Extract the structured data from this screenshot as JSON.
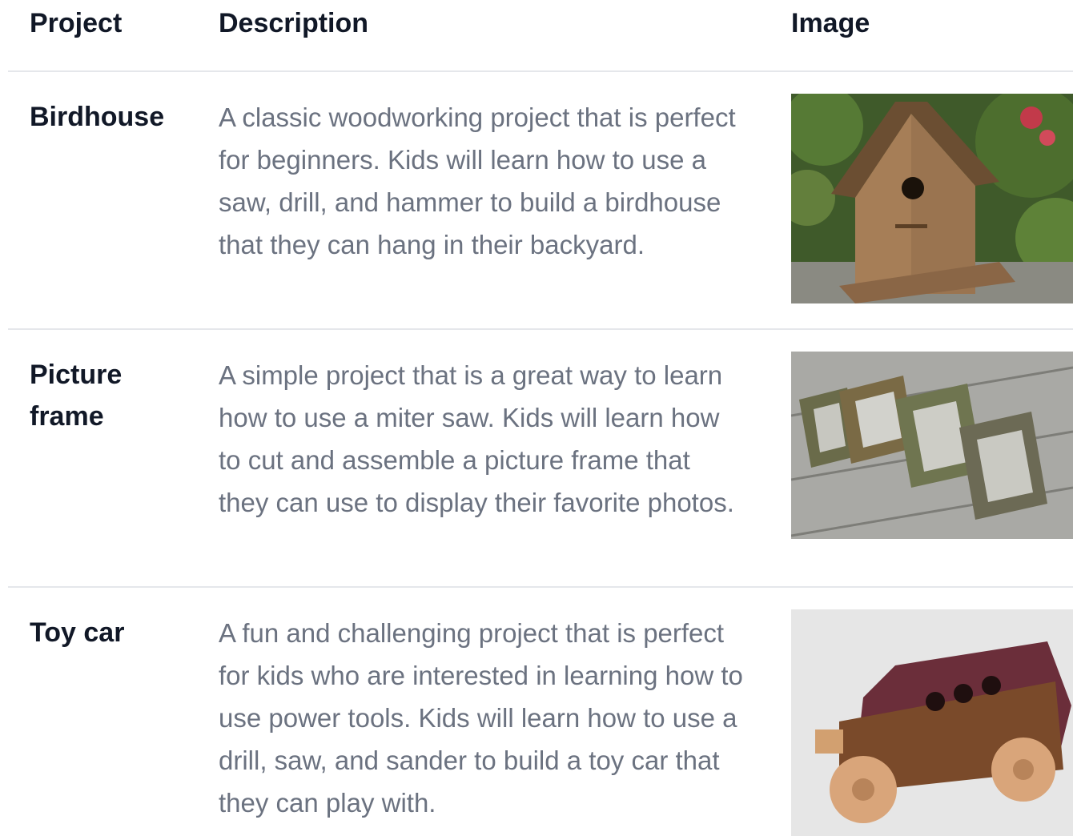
{
  "table": {
    "headers": {
      "project": "Project",
      "description": "Description",
      "image": "Image"
    },
    "rows": [
      {
        "project": "Birdhouse",
        "description": "A classic woodworking project that is perfect for beginners. Kids will learn how to use a saw, drill, and hammer to build a birdhouse that they can hang in their backyard.",
        "image_alt": "wooden birdhouse photo"
      },
      {
        "project": "Picture frame",
        "description": "A simple project that is a great way to learn how to use a miter saw. Kids will learn how to cut and assemble a picture frame that they can use to display their favorite photos.",
        "image_alt": "wooden picture frames photo"
      },
      {
        "project": "Toy car",
        "description": "A fun and challenging project that is perfect for kids who are interested in learning how to use power tools. Kids will learn how to use a drill, saw, and sander to build a toy car that they can play with.",
        "image_alt": "wooden toy car photo"
      }
    ]
  }
}
